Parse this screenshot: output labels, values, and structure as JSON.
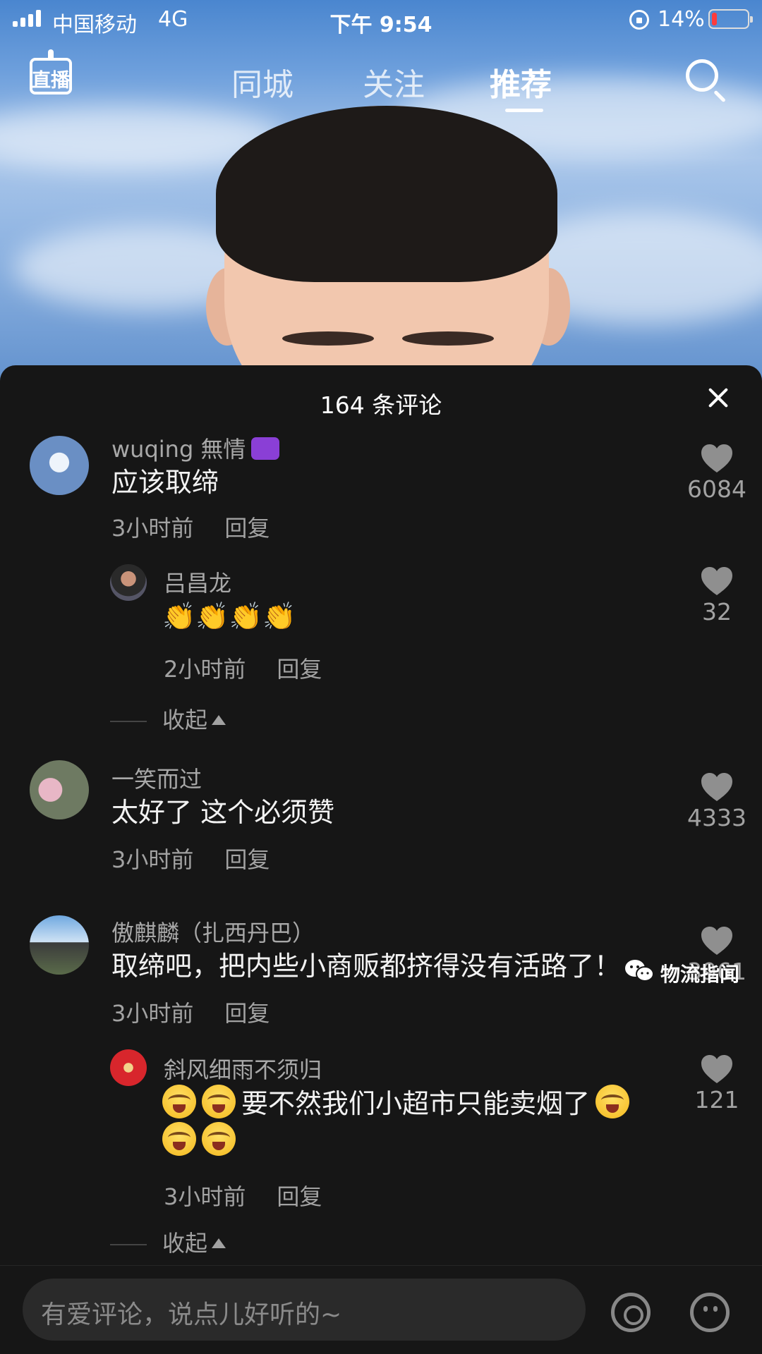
{
  "status_bar": {
    "carrier": "中国移动",
    "network": "4G",
    "time": "下午 9:54",
    "battery_percent": "14%",
    "battery_level": 0.14,
    "battery_color": "#ff3b3b"
  },
  "nav": {
    "live_label": "直播",
    "tabs": [
      {
        "label": "同城",
        "active": false
      },
      {
        "label": "关注",
        "active": false
      },
      {
        "label": "推荐",
        "active": true
      }
    ]
  },
  "comments_panel": {
    "title": "164 条评论",
    "comments": [
      {
        "username": "wuqing 無情",
        "text": "应该取缔",
        "time": "3小时前",
        "reply_label": "回复",
        "likes": "6084",
        "replies": [
          {
            "username": "吕昌龙",
            "text": "👏👏👏👏",
            "time": "2小时前",
            "reply_label": "回复",
            "likes": "32"
          }
        ],
        "collapse_label": "收起"
      },
      {
        "username": "一笑而过",
        "text": "太好了 这个必须赞",
        "time": "3小时前",
        "reply_label": "回复",
        "likes": "4333"
      },
      {
        "username": "傲麒麟（扎西丹巴）",
        "text": "取缔吧，把内些小商贩都挤得没有活路了！",
        "time": "3小时前",
        "reply_label": "回复",
        "likes": "3961",
        "replies": [
          {
            "username": "斜风细雨不须归",
            "text": "要不然我们小超市只能卖烟了",
            "time": "3小时前",
            "reply_label": "回复",
            "likes": "121"
          }
        ],
        "collapse_label": "收起"
      }
    ]
  },
  "input": {
    "placeholder": "有爱评论，说点儿好听的~"
  },
  "watermark": "物流指闻",
  "icons": {
    "signal": "signal-icon",
    "rotation_lock": "rotation-lock-icon",
    "battery": "battery-icon",
    "live": "live-icon",
    "search": "search-icon",
    "close": "close-icon",
    "heart": "heart-icon",
    "at": "at-icon",
    "emoji": "emoji-icon",
    "wechat": "wechat-icon"
  }
}
